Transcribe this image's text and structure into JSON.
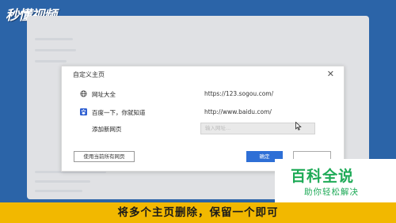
{
  "logo_text": "秒懂视频",
  "dialog": {
    "title": "自定义主页",
    "close_glyph": "✕",
    "rows": [
      {
        "name": "网址大全",
        "url": "https://123.sogou.com/",
        "icon": "globe-icon"
      },
      {
        "name": "百度一下，你就知道",
        "url": "http://www.baidu.com/",
        "icon": "baidu-paw-icon"
      }
    ],
    "add_label": "添加新网页",
    "add_placeholder": "输入网址...",
    "use_current_button": "使用当前所有网页",
    "ok_button": "确定",
    "cancel_button": ""
  },
  "badge": {
    "title": "百科全说",
    "subtitle": "助你轻松解决"
  },
  "caption": "将多个主页删除，保留一个即可",
  "colors": {
    "frame": "#2b64a8",
    "accent_yellow": "#f2b800",
    "badge_green": "#1eaa57",
    "primary_button": "#2e6fd6"
  }
}
